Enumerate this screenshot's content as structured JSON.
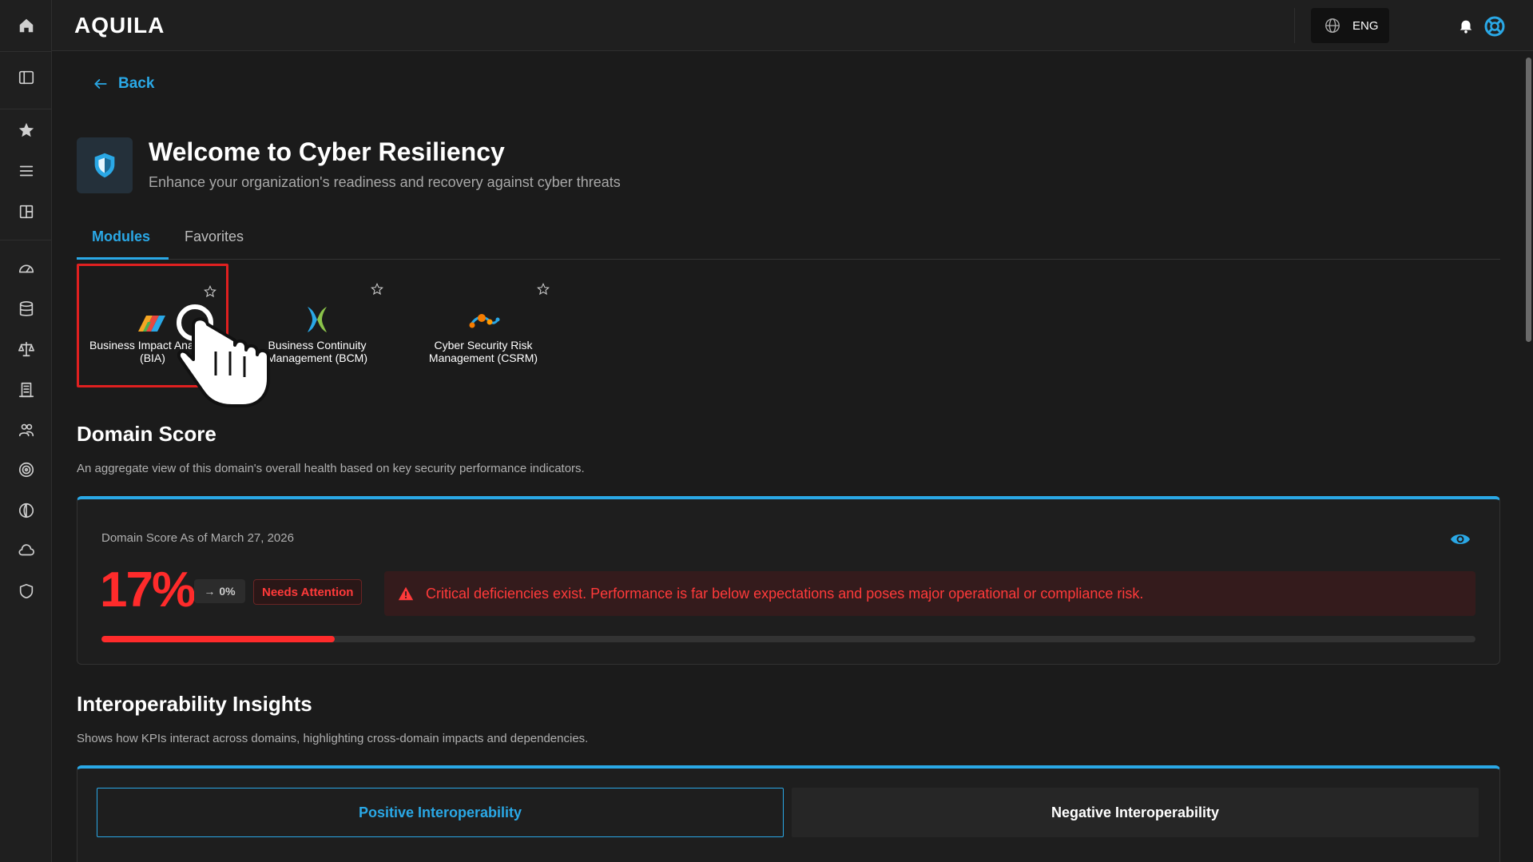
{
  "app": {
    "logo": "AQUILA"
  },
  "topbar": {
    "language": "ENG"
  },
  "nav": {
    "back_label": "Back"
  },
  "header": {
    "title": "Welcome to Cyber Resiliency",
    "subtitle": "Enhance your organization's readiness and recovery against cyber threats"
  },
  "tabs": [
    {
      "label": "Modules",
      "active": true
    },
    {
      "label": "Favorites",
      "active": false
    }
  ],
  "modules": [
    {
      "label": "Business Impact Analysis (BIA)",
      "icon": "bia-logo-icon",
      "selected": true
    },
    {
      "label": "Business Continuity Management (BCM)",
      "icon": "bcm-logo-icon",
      "selected": false
    },
    {
      "label": "Cyber Security Risk Management (CSRM)",
      "icon": "csrm-logo-icon",
      "selected": false
    }
  ],
  "domain_score": {
    "title": "Domain Score",
    "description": "An aggregate view of this domain's overall health based on key security performance indicators.",
    "as_of": "Domain Score As of March 27, 2026",
    "value": "17%",
    "value_fraction": 0.17,
    "trend": "0%",
    "status": "Needs Attention",
    "alert": "Critical deficiencies exist. Performance is far below expectations and poses major operational or compliance risk."
  },
  "interoperability": {
    "title": "Interoperability Insights",
    "description": "Shows how KPIs interact across domains, highlighting cross-domain impacts and dependencies.",
    "tabs": [
      "Positive Interoperability",
      "Negative Interoperability"
    ]
  },
  "colors": {
    "accent": "#2aa8e6",
    "danger": "#ff2b2b",
    "background": "#1b1b1b"
  }
}
